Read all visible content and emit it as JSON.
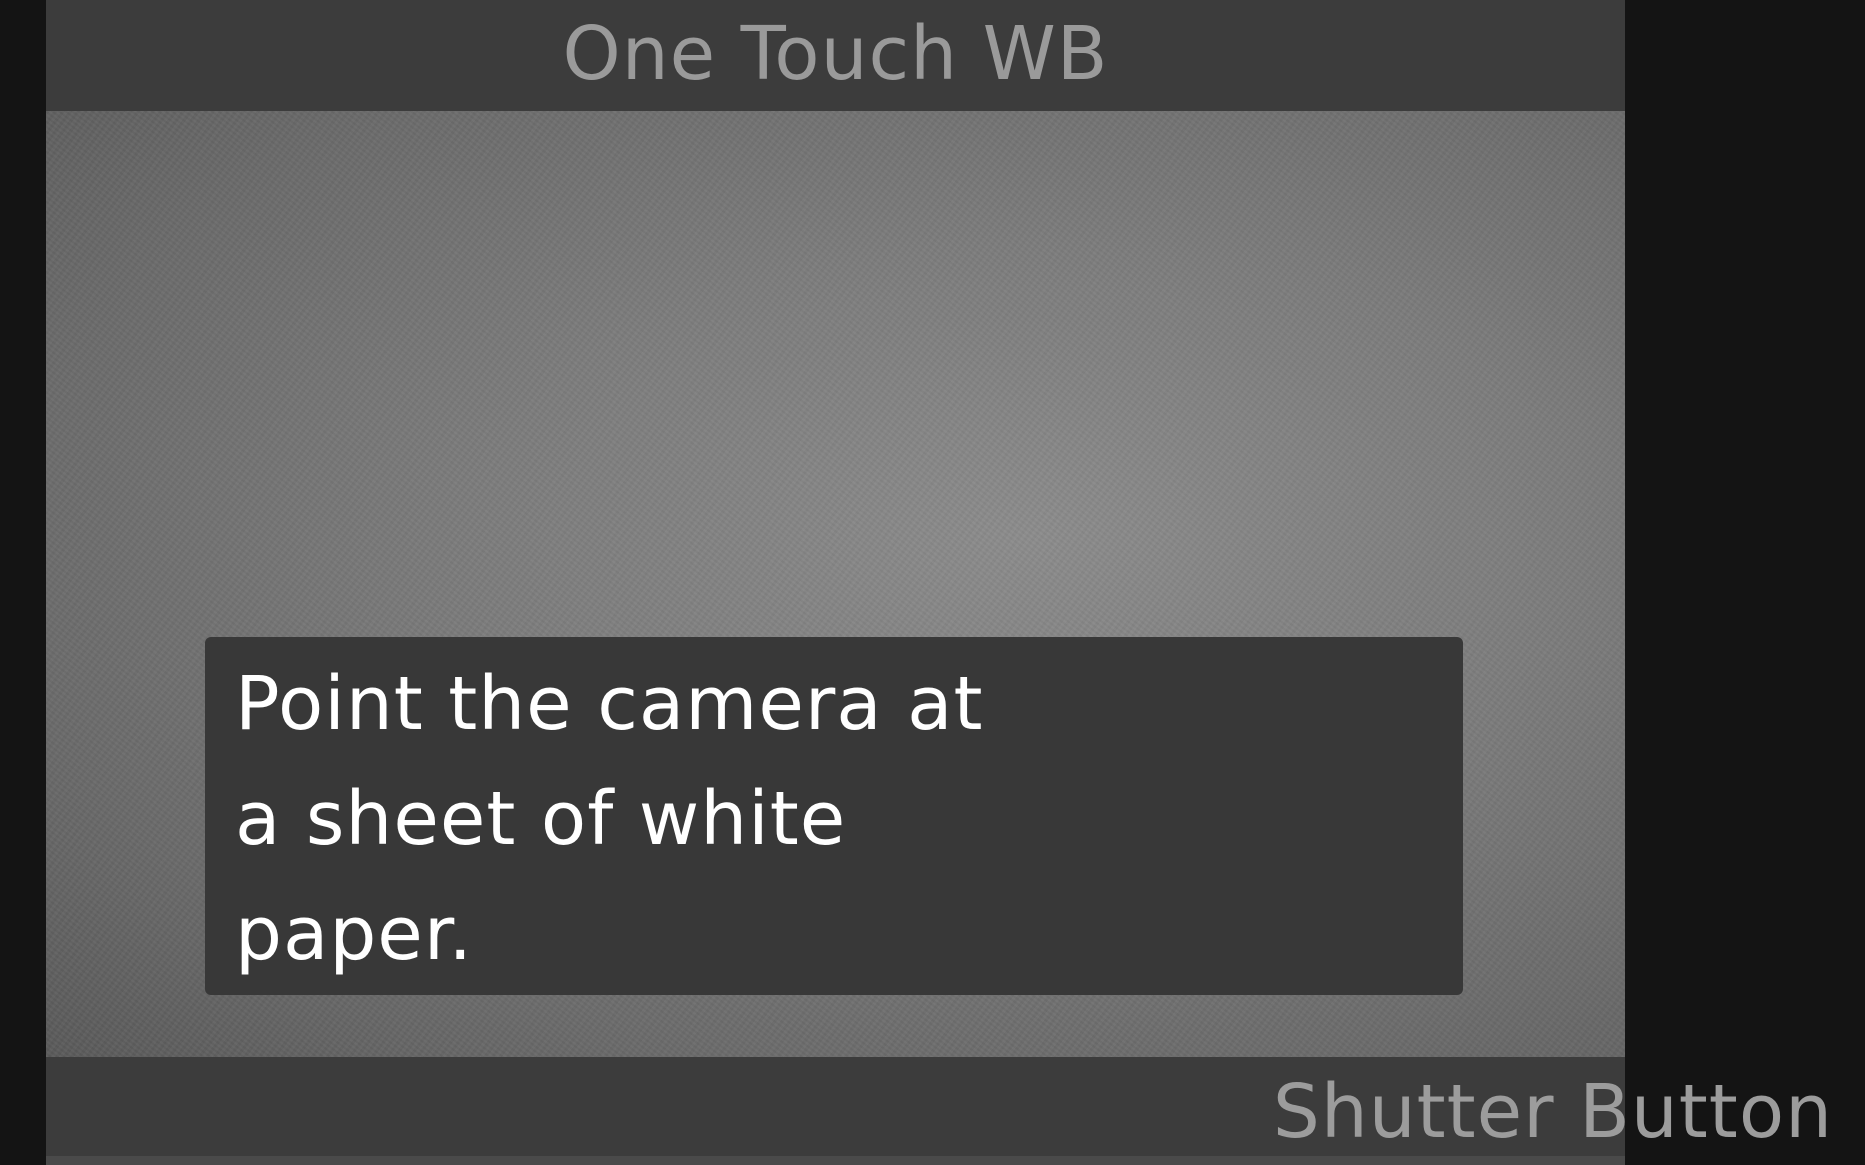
{
  "header": {
    "title": "One Touch WB"
  },
  "message": {
    "lines": [
      "Point the camera at",
      "a sheet of white",
      "paper."
    ]
  },
  "footer": {
    "button_hint": "Shutter Button"
  },
  "colors": {
    "bar_background": "#3c3c3c",
    "message_background": "#383838",
    "title_text": "#9a9a9a",
    "message_text": "#ffffff",
    "frame": "#141414"
  }
}
